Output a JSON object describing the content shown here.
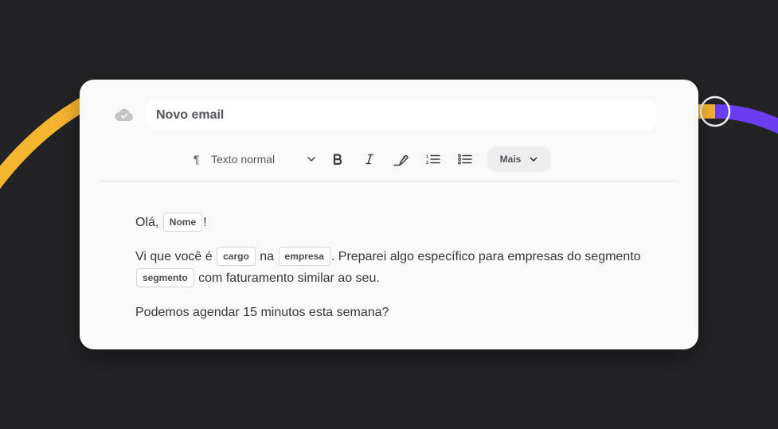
{
  "composer": {
    "subject": "Novo email",
    "toolbar": {
      "text_style": "Texto normal",
      "more_label": "Mais"
    },
    "body": {
      "greeting_prefix": "Olá,",
      "greeting_var": "Nome",
      "greeting_suffix": "!",
      "p2_part1": "Vi que você é",
      "p2_var1": "cargo",
      "p2_part2": "na",
      "p2_var2": "empresa",
      "p2_part3": ". Preparei algo específico para empresas do segmento",
      "p2_var3": "segmento",
      "p2_part4": "com faturamento similar ao seu.",
      "p3": "Podemos agendar 15 minutos esta semana?"
    }
  },
  "icons": {
    "save_status": "cloud-check-icon",
    "paragraph": "pilcrow-icon",
    "dropdown": "chevron-down-icon",
    "bold": "bold-icon",
    "italic": "italic-icon",
    "highlight": "highlighter-icon",
    "ordered_list": "ordered-list-icon",
    "bullet_list": "bullet-list-icon"
  },
  "colors": {
    "background": "#232225",
    "card": "#f9f9f9",
    "accent_yellow": "#f6b530",
    "accent_purple": "#6a3ef0"
  }
}
